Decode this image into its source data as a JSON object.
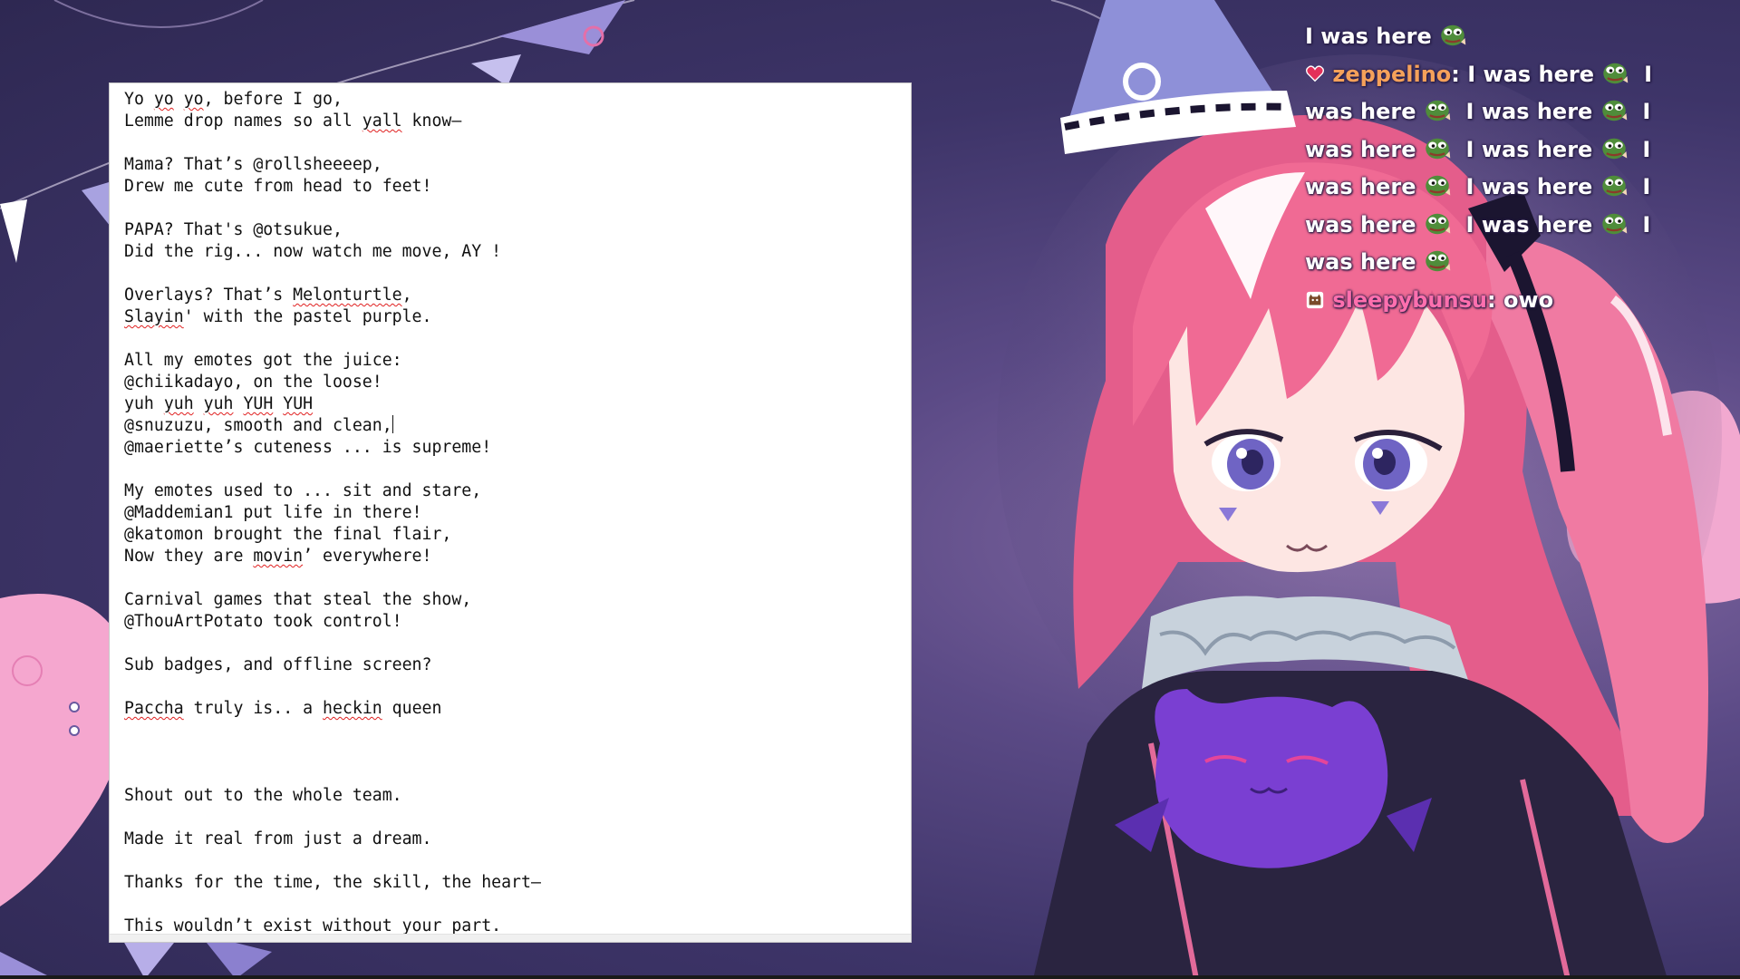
{
  "editor": {
    "lines": [
      {
        "text": [
          "Yo ",
          {
            "s": "yo"
          },
          " ",
          {
            "s": "yo"
          },
          ", before I go,"
        ]
      },
      {
        "text": [
          "Lemme drop names so all ",
          {
            "s": "yall"
          },
          " know—"
        ]
      },
      {
        "text": [
          ""
        ]
      },
      {
        "text": [
          "Mama? That’s @rollsheeeep,"
        ]
      },
      {
        "text": [
          "Drew me cute from head to feet!"
        ]
      },
      {
        "text": [
          ""
        ]
      },
      {
        "text": [
          "PAPA? That's @otsukue,"
        ]
      },
      {
        "text": [
          "Did the rig... now watch me move, AY !"
        ]
      },
      {
        "text": [
          ""
        ]
      },
      {
        "text": [
          "Overlays? That’s ",
          {
            "s": "Melonturtle"
          },
          ","
        ]
      },
      {
        "text": [
          {
            "s": "Slayin"
          },
          "' with the pastel purple."
        ]
      },
      {
        "text": [
          ""
        ]
      },
      {
        "text": [
          "All my emotes got the juice:"
        ]
      },
      {
        "text": [
          "@chiikadayo, on the loose!"
        ]
      },
      {
        "text": [
          "yuh ",
          {
            "s": "yuh"
          },
          " ",
          {
            "s": "yuh"
          },
          " ",
          {
            "s": "YUH"
          },
          " ",
          {
            "s": "YUH"
          }
        ]
      },
      {
        "text": [
          "@snuzuzu, smooth and clean,"
        ],
        "caret": true
      },
      {
        "text": [
          "@maeriette’s cuteness ... is supreme!"
        ]
      },
      {
        "text": [
          ""
        ]
      },
      {
        "text": [
          "My emotes used to ... sit and stare,"
        ]
      },
      {
        "text": [
          "@Maddemian1 put life in there!"
        ]
      },
      {
        "text": [
          "@katomon brought the final flair,"
        ]
      },
      {
        "text": [
          "Now they are ",
          {
            "s": "movin"
          },
          "’ everywhere!"
        ]
      },
      {
        "text": [
          ""
        ]
      },
      {
        "text": [
          "Carnival games that steal the show,"
        ]
      },
      {
        "text": [
          "@ThouArtPotato took control!"
        ]
      },
      {
        "text": [
          ""
        ]
      },
      {
        "text": [
          "Sub badges, and offline screen?"
        ]
      },
      {
        "text": [
          ""
        ]
      },
      {
        "text": [
          {
            "s": "Paccha"
          },
          " truly is.. a ",
          {
            "s": "heckin"
          },
          " queen"
        ]
      },
      {
        "text": [
          ""
        ]
      },
      {
        "text": [
          ""
        ]
      },
      {
        "text": [
          ""
        ]
      },
      {
        "text": [
          "Shout out to the whole team."
        ]
      },
      {
        "text": [
          ""
        ]
      },
      {
        "text": [
          "Made it real from just a dream."
        ]
      },
      {
        "text": [
          ""
        ]
      },
      {
        "text": [
          "Thanks for the time, the skill, the heart—"
        ]
      },
      {
        "text": [
          ""
        ]
      },
      {
        "text": [
          "This wouldn’t exist without your part."
        ]
      }
    ]
  },
  "chat": {
    "lines": [
      {
        "parts": [
          {
            "t": "I was here "
          },
          {
            "emote": "pepe-emote"
          }
        ]
      },
      {
        "badge": "heart-badge",
        "user": "zeppelino",
        "user_style": "zep",
        "parts": [
          {
            "t": ": I was here "
          },
          {
            "emote": "pepe-emote"
          },
          {
            "t": "  I"
          }
        ]
      },
      {
        "parts": [
          {
            "t": "was here "
          },
          {
            "emote": "pepe-emote"
          },
          {
            "t": "  I was here "
          },
          {
            "emote": "pepe-emote"
          },
          {
            "t": "  I"
          }
        ]
      },
      {
        "parts": [
          {
            "t": "was here "
          },
          {
            "emote": "pepe-emote"
          },
          {
            "t": "  I was here "
          },
          {
            "emote": "pepe-emote"
          },
          {
            "t": "  I"
          }
        ]
      },
      {
        "parts": [
          {
            "t": "was here "
          },
          {
            "emote": "pepe-emote"
          },
          {
            "t": "  I was here "
          },
          {
            "emote": "pepe-emote"
          },
          {
            "t": "  I"
          }
        ]
      },
      {
        "parts": [
          {
            "t": "was here "
          },
          {
            "emote": "pepe-emote"
          },
          {
            "t": "  I was here "
          },
          {
            "emote": "pepe-emote"
          },
          {
            "t": "  I"
          }
        ]
      },
      {
        "parts": [
          {
            "t": "was here "
          },
          {
            "emote": "pepe-emote"
          }
        ]
      },
      {
        "badge": "cup-badge",
        "user": "sleepybunsu",
        "user_style": "sleep",
        "parts": [
          {
            "t": ": owo"
          }
        ]
      }
    ]
  },
  "colors": {
    "accent_pink": "#ff6fae",
    "bg_purple": "#3d3468",
    "hair_pink": "#f06a94"
  }
}
